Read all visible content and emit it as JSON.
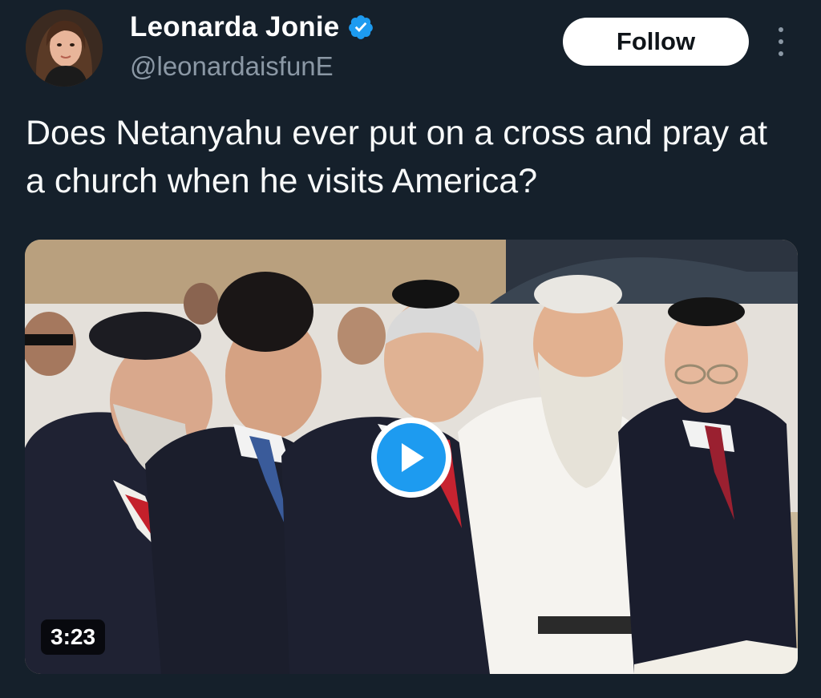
{
  "author": {
    "display_name": "Leonarda Jonie",
    "handle": "@leonardaisfunE",
    "verified": true,
    "verified_icon": "verified-badge-icon"
  },
  "actions": {
    "follow_label": "Follow",
    "more_icon": "more-options-icon"
  },
  "tweet": {
    "text": "Does Netanyahu ever put on a cross and pray at a church when he visits America?"
  },
  "media": {
    "type": "video",
    "duration": "3:23",
    "play_icon": "play-icon"
  },
  "colors": {
    "background": "#15202b",
    "accent": "#1d9bf0",
    "secondary_text": "#8b98a5"
  }
}
